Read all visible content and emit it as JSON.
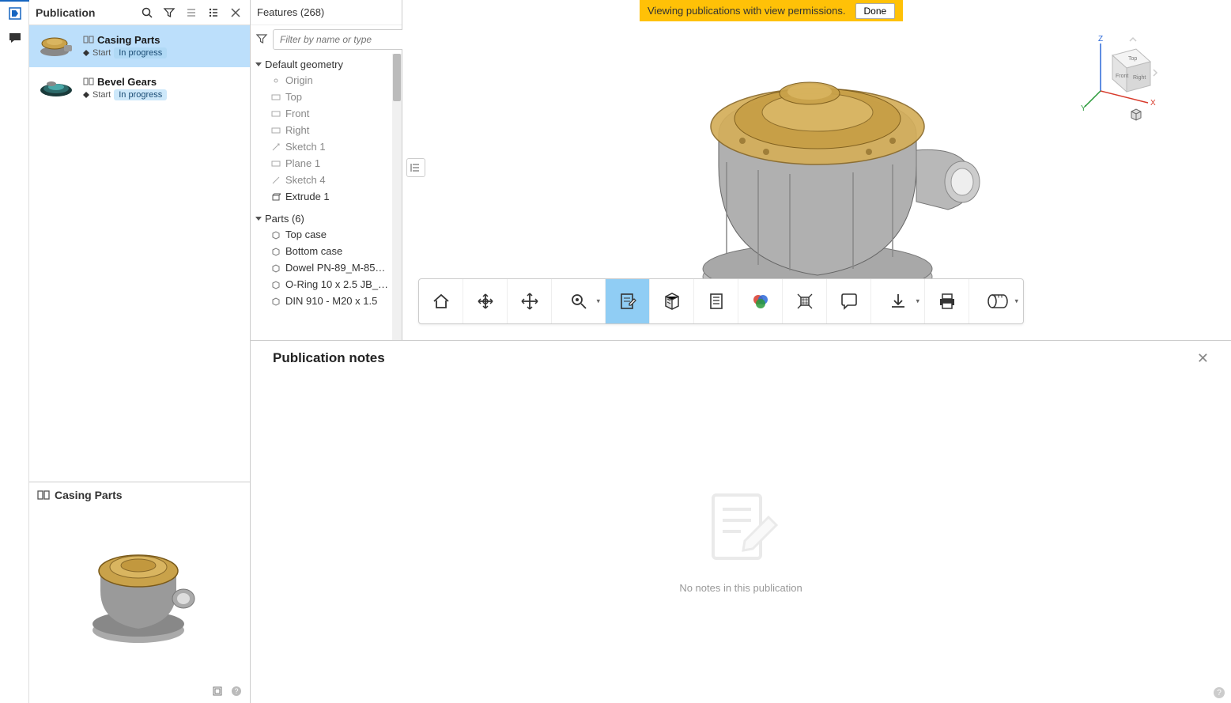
{
  "left_rail": {
    "panel_icon": "publication-panel-icon",
    "comment_icon": "comment-icon"
  },
  "publication_panel": {
    "title": "Publication",
    "icons": [
      "search",
      "filter",
      "list-collapse",
      "list-expand",
      "close"
    ],
    "items": [
      {
        "name": "Casing Parts",
        "stage": "Start",
        "badge": "In progress",
        "selected": true
      },
      {
        "name": "Bevel Gears",
        "stage": "Start",
        "badge": "In progress",
        "selected": false
      }
    ],
    "preview": {
      "title": "Casing Parts"
    }
  },
  "features_panel": {
    "title": "Features (268)",
    "filter_placeholder": "Filter by name or type",
    "groups": [
      {
        "name": "Default geometry",
        "expanded": true,
        "items": [
          {
            "label": "Origin",
            "icon": "origin-icon"
          },
          {
            "label": "Top",
            "icon": "plane-icon"
          },
          {
            "label": "Front",
            "icon": "plane-icon"
          },
          {
            "label": "Right",
            "icon": "plane-icon"
          },
          {
            "label": "Sketch 1",
            "icon": "sketch-icon"
          },
          {
            "label": "Plane 1",
            "icon": "plane-icon"
          },
          {
            "label": "Sketch 4",
            "icon": "sketch-icon"
          },
          {
            "label": "Extrude 1",
            "icon": "extrude-icon",
            "dark": true
          }
        ]
      },
      {
        "name": "Parts (6)",
        "expanded": true,
        "items": [
          {
            "label": "Top case",
            "icon": "part-icon",
            "dark": true
          },
          {
            "label": "Bottom case",
            "icon": "part-icon",
            "dark": true
          },
          {
            "label": "Dowel PN-89_M-85…",
            "icon": "part-icon",
            "dark": true
          },
          {
            "label": "O-Ring 10 x 2.5 JB_…",
            "icon": "part-icon",
            "dark": true
          },
          {
            "label": "DIN 910 - M20 x 1.5",
            "icon": "part-icon",
            "dark": true
          }
        ]
      }
    ]
  },
  "banner": {
    "message": "Viewing publications with view permissions.",
    "button": "Done"
  },
  "view_cube": {
    "axes": {
      "x": "X",
      "y": "Y",
      "z": "Z"
    },
    "faces": {
      "top": "Top",
      "front": "Front",
      "right": "Right"
    }
  },
  "toolbar": {
    "buttons": [
      {
        "name": "home",
        "dropdown": false
      },
      {
        "name": "orbit",
        "dropdown": false
      },
      {
        "name": "pan",
        "dropdown": false
      },
      {
        "name": "zoom",
        "dropdown": true
      },
      {
        "name": "notes",
        "dropdown": false,
        "active": true
      },
      {
        "name": "section",
        "dropdown": false
      },
      {
        "name": "properties",
        "dropdown": false
      },
      {
        "name": "appearance",
        "dropdown": false
      },
      {
        "name": "isolate",
        "dropdown": false
      },
      {
        "name": "comment",
        "dropdown": false
      },
      {
        "name": "download",
        "dropdown": true
      },
      {
        "name": "print",
        "dropdown": false
      },
      {
        "name": "measure",
        "dropdown": true
      }
    ]
  },
  "notes_panel": {
    "title": "Publication notes",
    "empty_text": "No notes in this publication"
  }
}
